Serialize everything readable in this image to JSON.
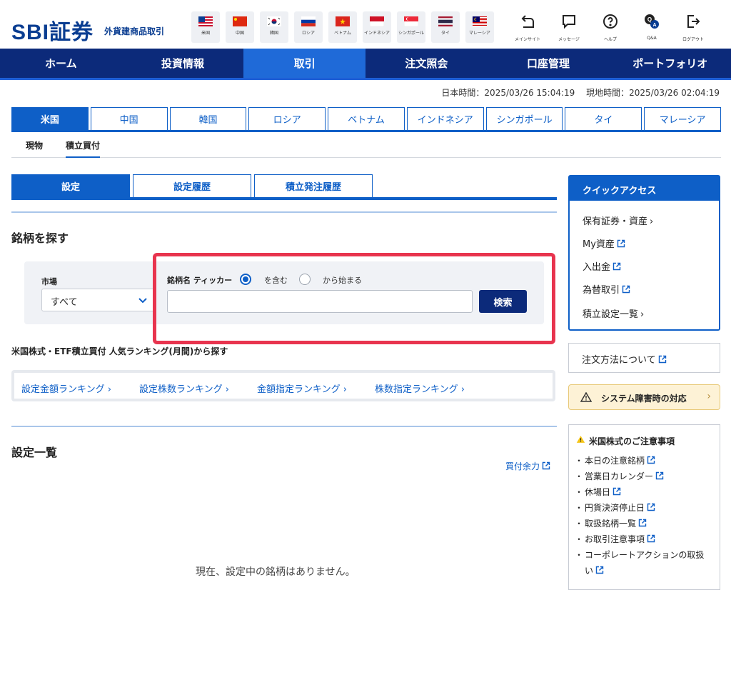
{
  "header": {
    "logo": "SBI証券",
    "logo_sub": "外貨建商品取引",
    "flags": [
      {
        "label": "米国",
        "icon": "us-flag-icon"
      },
      {
        "label": "中国",
        "icon": "china-flag-icon"
      },
      {
        "label": "韓国",
        "icon": "korea-flag-icon"
      },
      {
        "label": "ロシア",
        "icon": "russia-flag-icon"
      },
      {
        "label": "ベトナム",
        "icon": "vietnam-flag-icon"
      },
      {
        "label": "インドネシア",
        "icon": "indonesia-flag-icon"
      },
      {
        "label": "シンガポール",
        "icon": "singapore-flag-icon"
      },
      {
        "label": "タイ",
        "icon": "thailand-flag-icon"
      },
      {
        "label": "マレーシア",
        "icon": "malaysia-flag-icon"
      }
    ],
    "utils": [
      {
        "label": "メインサイト",
        "icon": "return-icon"
      },
      {
        "label": "メッセージ",
        "icon": "message-icon"
      },
      {
        "label": "ヘルプ",
        "icon": "help-icon"
      },
      {
        "label": "Q&A",
        "icon": "qa-icon"
      },
      {
        "label": "ログアウト",
        "icon": "logout-icon"
      }
    ]
  },
  "nav": {
    "items": [
      "ホーム",
      "投資情報",
      "取引",
      "注文照会",
      "口座管理",
      "ポートフォリオ"
    ],
    "active_index": 2
  },
  "time": {
    "japan": "日本時間：2025/03/26 15:04:19",
    "local": "現地時間：2025/03/26 02:04:19"
  },
  "country_tabs": {
    "items": [
      "米国",
      "中国",
      "韓国",
      "ロシア",
      "ベトナム",
      "インドネシア",
      "シンガポール",
      "タイ",
      "マレーシア"
    ],
    "active_index": 0
  },
  "subtabs": {
    "items": [
      "現物",
      "積立買付"
    ],
    "active_index": 1
  },
  "setting_tabs": {
    "items": [
      "設定",
      "設定履歴",
      "積立発注履歴"
    ],
    "active_index": 0
  },
  "search": {
    "title": "銘柄を探す",
    "market_label": "市場",
    "market_value": "すべて",
    "name_label": "銘柄名 ティッカー",
    "radio_contains": "を含む",
    "radio_starts": "から始まる",
    "radio_selected": "contains",
    "input_value": "",
    "button": "検索"
  },
  "ranking": {
    "title": "米国株式・ETF積立買付 人気ランキング(月間)から探す",
    "links": [
      "設定金額ランキング",
      "設定株数ランキング",
      "金額指定ランキング",
      "株数指定ランキング"
    ]
  },
  "settings_list": {
    "title": "設定一覧",
    "buying_power": "買付余力",
    "empty": "現在、設定中の銘柄はありません。"
  },
  "quick_access": {
    "title": "クイックアクセス",
    "links": [
      {
        "label": "保有証券・資産",
        "type": "arrow"
      },
      {
        "label": "My資産",
        "type": "external"
      },
      {
        "label": "入出金",
        "type": "external"
      },
      {
        "label": "為替取引",
        "type": "external"
      },
      {
        "label": "積立設定一覧",
        "type": "arrow"
      }
    ]
  },
  "order_method": "注文方法について",
  "system_failure": "システム障害時の対応",
  "notice": {
    "title": "米国株式のご注意事項",
    "items": [
      "本日の注意銘柄",
      "営業日カレンダー",
      "休場日",
      "円貨決済停止日",
      "取扱銘柄一覧",
      "お取引注意事項",
      "コーポレートアクションの取扱い"
    ]
  },
  "colors": {
    "brand": "#0a3d91",
    "nav_bg": "#0c2a7a",
    "accent": "#0e5fc7",
    "highlight": "#e8344e"
  }
}
